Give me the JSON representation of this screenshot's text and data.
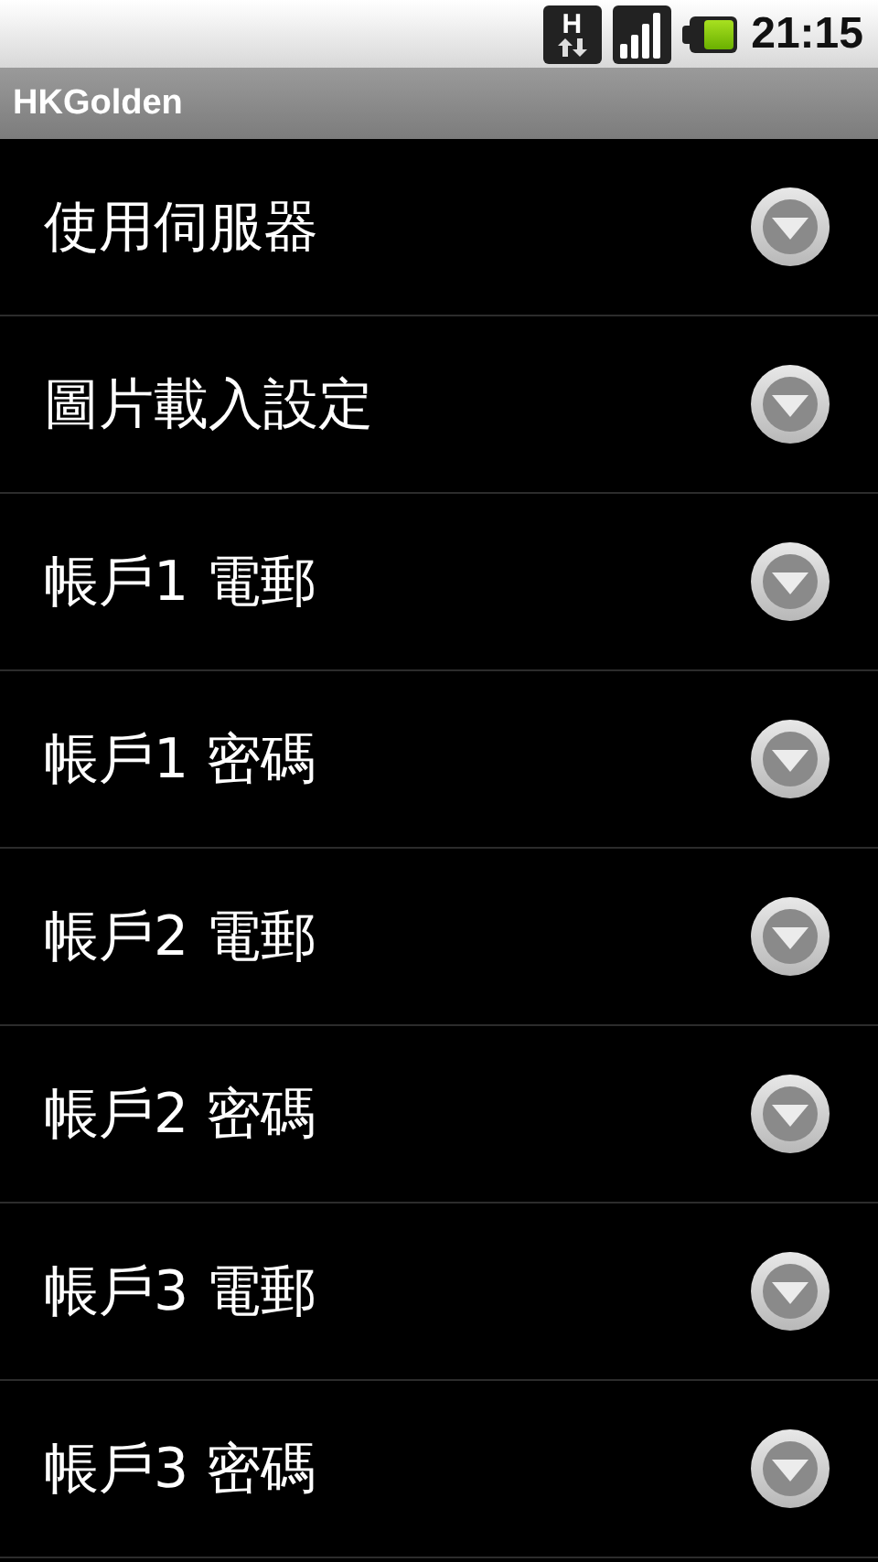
{
  "status_bar": {
    "network_type": "H",
    "time": "21:15"
  },
  "title_bar": {
    "title": "HKGolden"
  },
  "settings": [
    {
      "label": "使用伺服器"
    },
    {
      "label": "圖片載入設定"
    },
    {
      "label": "帳戶1 電郵"
    },
    {
      "label": "帳戶1 密碼"
    },
    {
      "label": "帳戶2 電郵"
    },
    {
      "label": "帳戶2 密碼"
    },
    {
      "label": "帳戶3 電郵"
    },
    {
      "label": "帳戶3 密碼"
    }
  ]
}
